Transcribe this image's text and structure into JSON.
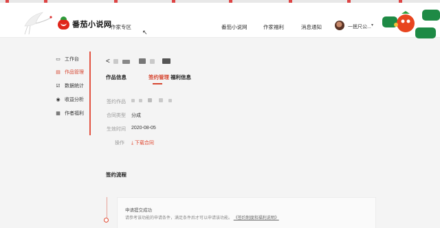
{
  "header": {
    "logo_text": "番茄小说网",
    "zone_label": "作家专区",
    "nav": [
      "番茄小说网",
      "作家福利",
      "消息通知"
    ],
    "username": "一抿尺公...",
    "caret": "▾"
  },
  "sidebar": {
    "items": [
      {
        "icon": "monitor-icon",
        "glyph": "▭",
        "label": "工作台"
      },
      {
        "icon": "book-icon",
        "glyph": "▤",
        "label": "作品管理",
        "active": true
      },
      {
        "icon": "chart-icon",
        "glyph": "☑",
        "label": "数据统计"
      },
      {
        "icon": "coin-icon",
        "glyph": "◉",
        "label": "收益分析"
      },
      {
        "icon": "gift-icon",
        "glyph": "▦",
        "label": "作者福利"
      }
    ]
  },
  "main": {
    "back_glyph": "<",
    "tabs": [
      "作品信息",
      "签约管理",
      "福利信息"
    ],
    "active_tab": "签约管理",
    "rows": [
      {
        "label": "签约作品",
        "value": ""
      },
      {
        "label": "合同类型",
        "value": "分成"
      },
      {
        "label": "生效时间",
        "value": "2020-08-05"
      },
      {
        "label": "操作",
        "value": "⤓ 下载合同"
      }
    ],
    "flow_title": "签约流程",
    "flow_card": {
      "title": "申请提交成功",
      "desc": "请参考该功能的申请条件，满足条件后才可以申请该功能。",
      "link": "《签约制度和福利说明》"
    }
  },
  "colors": {
    "accent": "#d6452f",
    "logo_red": "#e0261b",
    "logo_green": "#2c9c3a"
  }
}
